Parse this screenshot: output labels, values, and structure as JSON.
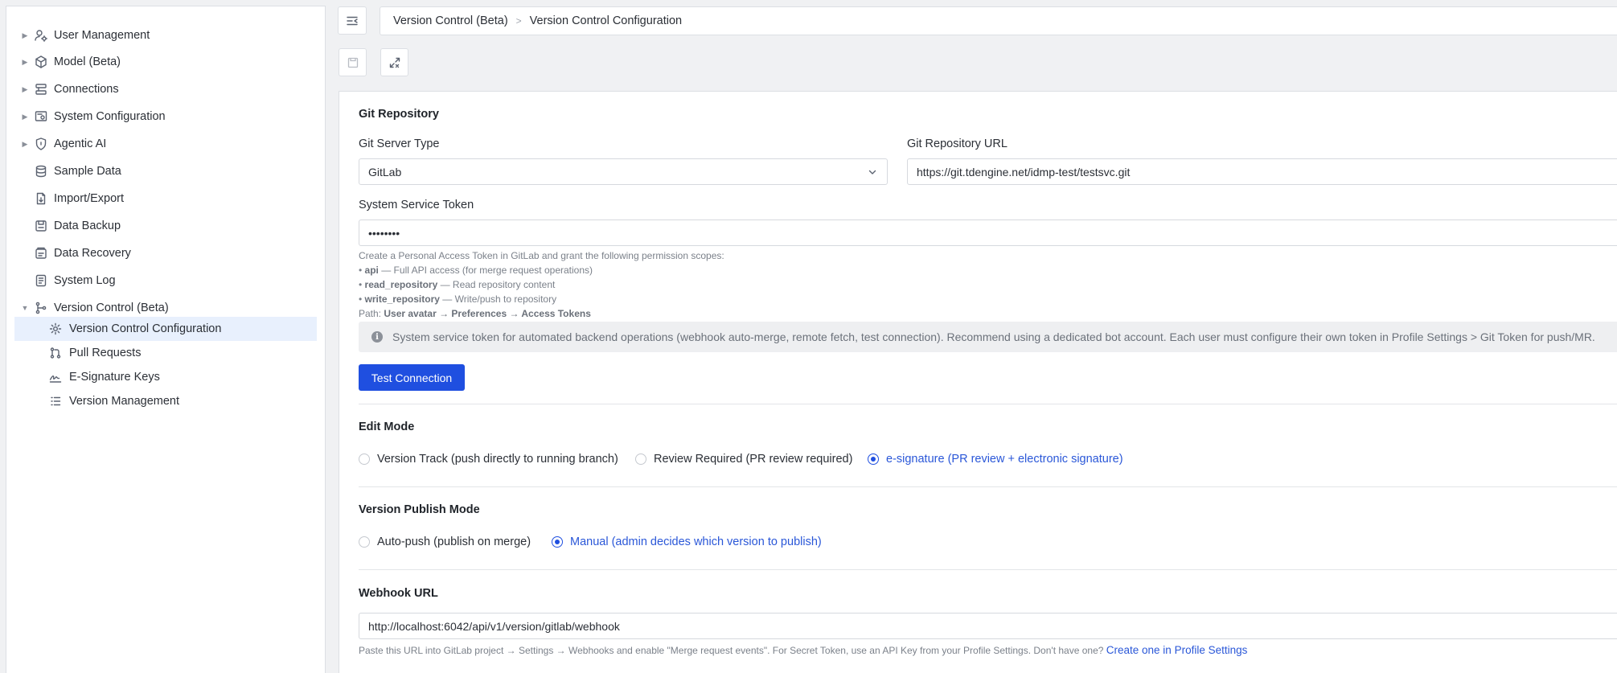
{
  "sidebar": {
    "items": [
      {
        "label": "User Management",
        "icon": "user-gear-icon",
        "expandable": true
      },
      {
        "label": "Model (Beta)",
        "icon": "cube-icon",
        "expandable": true
      },
      {
        "label": "Connections",
        "icon": "connections-icon",
        "expandable": true
      },
      {
        "label": "System Configuration",
        "icon": "settings-panel-icon",
        "expandable": true
      },
      {
        "label": "Agentic AI",
        "icon": "shield-ai-icon",
        "expandable": true
      },
      {
        "label": "Sample Data",
        "icon": "database-icon",
        "expandable": false
      },
      {
        "label": "Import/Export",
        "icon": "import-export-icon",
        "expandable": false
      },
      {
        "label": "Data Backup",
        "icon": "backup-icon",
        "expandable": false
      },
      {
        "label": "Data Recovery",
        "icon": "recovery-icon",
        "expandable": false
      },
      {
        "label": "System Log",
        "icon": "log-icon",
        "expandable": false
      },
      {
        "label": "Version Control (Beta)",
        "icon": "branch-icon",
        "expandable": true,
        "expanded": true
      }
    ],
    "subitems": [
      {
        "label": "Version Control Configuration",
        "icon": "gear-icon",
        "active": true
      },
      {
        "label": "Pull Requests",
        "icon": "pull-request-icon"
      },
      {
        "label": "E-Signature Keys",
        "icon": "signature-icon"
      },
      {
        "label": "Version Management",
        "icon": "list-icon"
      }
    ]
  },
  "breadcrumb": {
    "parent": "Version Control (Beta)",
    "current": "Version Control Configuration"
  },
  "git": {
    "section_title": "Git Repository",
    "server_type_label": "Git Server Type",
    "server_type_value": "GitLab",
    "repo_url_label": "Git Repository URL",
    "repo_url_value": "https://git.tdengine.net/idmp-test/testsvc.git",
    "token_label": "System Service Token",
    "token_value": "••••••••",
    "hint_intro": "Create a Personal Access Token in GitLab and grant the following permission scopes:",
    "scopes": [
      {
        "name": "api",
        "desc": " — Full API access (for merge request operations)"
      },
      {
        "name": "read_repository",
        "desc": " — Read repository content"
      },
      {
        "name": "write_repository",
        "desc": " — Write/push to repository"
      }
    ],
    "path_label": "Path: ",
    "path_steps": [
      "User avatar",
      "Preferences",
      "Access Tokens"
    ],
    "path_arrow": " → ",
    "info_text": "System service token for automated backend operations (webhook auto-merge, remote fetch, test connection). Recommend using a dedicated bot account. Each user must configure their own token in Profile Settings > Git Token for push/MR.",
    "test_button": "Test Connection"
  },
  "edit_mode": {
    "title": "Edit Mode",
    "options": [
      {
        "label": "Version Track (push directly to running branch)",
        "selected": false
      },
      {
        "label": "Review Required (PR review required)",
        "selected": false
      },
      {
        "label": "e-signature (PR review + electronic signature)",
        "selected": true
      }
    ]
  },
  "publish_mode": {
    "title": "Version Publish Mode",
    "options": [
      {
        "label": "Auto-push (publish on merge)",
        "selected": false
      },
      {
        "label": "Manual (admin decides which version to publish)",
        "selected": true
      }
    ]
  },
  "webhook": {
    "title": "Webhook URL",
    "value": "http://localhost:6042/api/v1/version/gitlab/webhook",
    "hint": "Paste this URL into GitLab project → Settings → Webhooks and enable \"Merge request events\". For Secret Token, use an API Key from your Profile Settings. Don't have one?",
    "link": "Create one in Profile Settings"
  },
  "colors": {
    "accent": "#1f4fe0",
    "active_bg": "#e8f0fd",
    "link": "#2a57d8"
  }
}
